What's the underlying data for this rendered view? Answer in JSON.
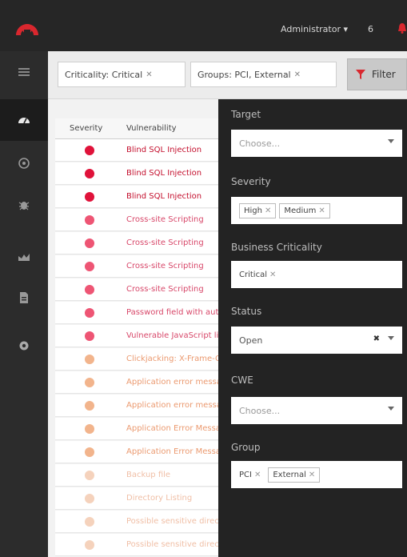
{
  "header": {
    "user": "Administrator ▾",
    "notification_count": "6",
    "logo_color": "#d9272e"
  },
  "sidebar": {
    "items": [
      {
        "icon": "menu-icon"
      },
      {
        "icon": "dashboard-icon"
      },
      {
        "icon": "target-icon"
      },
      {
        "icon": "bug-icon"
      },
      {
        "icon": "chart-icon"
      },
      {
        "icon": "report-icon"
      },
      {
        "icon": "settings-icon"
      }
    ]
  },
  "filterbar": {
    "chips": [
      {
        "label": "Criticality: Critical",
        "remove": "✕"
      },
      {
        "label": "Groups: PCI, External",
        "remove": "✕"
      }
    ],
    "filter_button": "Filter",
    "filter_icon_color": "#d9272e"
  },
  "table": {
    "headers": {
      "severity": "Severity",
      "vulnerability": "Vulnerability"
    },
    "rows": [
      {
        "severity": "high",
        "name": "Blind SQL Injection"
      },
      {
        "severity": "high",
        "name": "Blind SQL Injection"
      },
      {
        "severity": "high",
        "name": "Blind SQL Injection"
      },
      {
        "severity": "medium",
        "name": "Cross-site Scripting"
      },
      {
        "severity": "medium",
        "name": "Cross-site Scripting"
      },
      {
        "severity": "medium",
        "name": "Cross-site Scripting"
      },
      {
        "severity": "medium",
        "name": "Cross-site Scripting"
      },
      {
        "severity": "medium",
        "name": "Password field with autocomplete"
      },
      {
        "severity": "medium",
        "name": "Vulnerable JavaScript library"
      },
      {
        "severity": "low",
        "name": "Clickjacking: X-Frame-Options header missing"
      },
      {
        "severity": "low",
        "name": "Application error message"
      },
      {
        "severity": "low",
        "name": "Application error message"
      },
      {
        "severity": "low",
        "name": "Application Error Message"
      },
      {
        "severity": "low",
        "name": "Application Error Message"
      },
      {
        "severity": "info",
        "name": "Backup file"
      },
      {
        "severity": "info",
        "name": "Directory Listing"
      },
      {
        "severity": "info",
        "name": "Possible sensitive directories"
      },
      {
        "severity": "info",
        "name": "Possible sensitive directories"
      }
    ],
    "colors": {
      "high": "#e0123a",
      "medium": "#ee5574",
      "low": "#f2b48c",
      "info": "#f5d2bc",
      "high_text": "#c4102e",
      "medium_text": "#d8486a",
      "low_text": "#eb9a70",
      "info_text": "#f0bfa6"
    }
  },
  "panel": {
    "target": {
      "label": "Target",
      "placeholder": "Choose..."
    },
    "severity": {
      "label": "Severity",
      "tags": [
        "High",
        "Medium"
      ]
    },
    "criticality": {
      "label": "Business Criticality",
      "tags": [
        "Critical"
      ]
    },
    "status": {
      "label": "Status",
      "value": "Open",
      "clear": "✖"
    },
    "cwe": {
      "label": "CWE",
      "placeholder": "Choose..."
    },
    "group": {
      "label": "Group",
      "tags": [
        "PCI",
        "External"
      ]
    },
    "remove": "✕"
  }
}
